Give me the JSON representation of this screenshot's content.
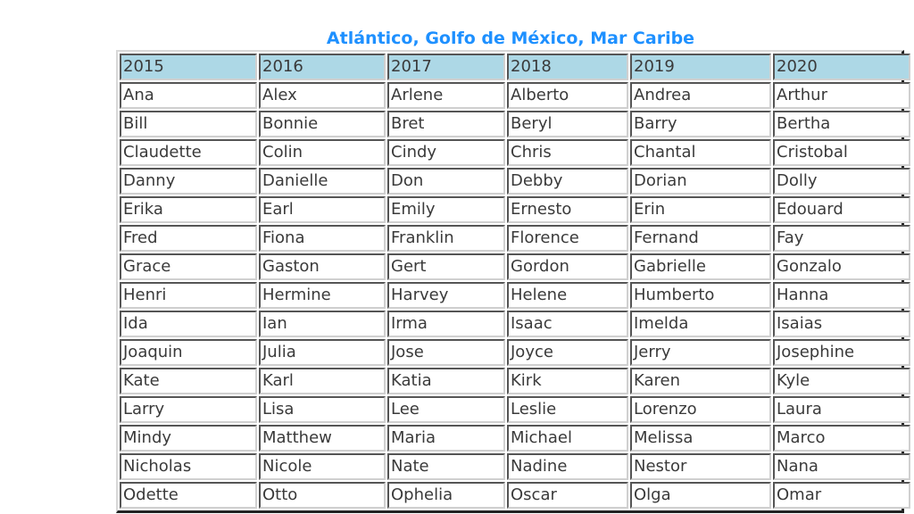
{
  "caption": "Atlántico, Golfo de México, Mar Caribe",
  "table": {
    "headers": [
      "2015",
      "2016",
      "2017",
      "2018",
      "2019",
      "2020"
    ],
    "rows": [
      [
        "Ana",
        "Alex",
        "Arlene",
        "Alberto",
        "Andrea",
        "Arthur"
      ],
      [
        "Bill",
        "Bonnie",
        "Bret",
        "Beryl",
        "Barry",
        "Bertha"
      ],
      [
        "Claudette",
        "Colin",
        "Cindy",
        "Chris",
        "Chantal",
        "Cristobal"
      ],
      [
        "Danny",
        "Danielle",
        "Don",
        "Debby",
        "Dorian",
        "Dolly"
      ],
      [
        "Erika",
        "Earl",
        "Emily",
        "Ernesto",
        "Erin",
        "Edouard"
      ],
      [
        "Fred",
        "Fiona",
        "Franklin",
        "Florence",
        "Fernand",
        "Fay"
      ],
      [
        "Grace",
        "Gaston",
        "Gert",
        "Gordon",
        "Gabrielle",
        "Gonzalo"
      ],
      [
        "Henri",
        "Hermine",
        "Harvey",
        "Helene",
        "Humberto",
        "Hanna"
      ],
      [
        "Ida",
        "Ian",
        "Irma",
        "Isaac",
        "Imelda",
        "Isaias"
      ],
      [
        "Joaquin",
        "Julia",
        "Jose",
        "Joyce",
        "Jerry",
        "Josephine"
      ],
      [
        "Kate",
        "Karl",
        "Katia",
        "Kirk",
        "Karen",
        "Kyle"
      ],
      [
        "Larry",
        "Lisa",
        "Lee",
        "Leslie",
        "Lorenzo",
        "Laura"
      ],
      [
        "Mindy",
        "Matthew",
        "Maria",
        "Michael",
        "Melissa",
        "Marco"
      ],
      [
        "Nicholas",
        "Nicole",
        "Nate",
        "Nadine",
        "Nestor",
        "Nana"
      ],
      [
        "Odette",
        "Otto",
        "Ophelia",
        "Oscar",
        "Olga",
        "Omar"
      ]
    ]
  },
  "colors": {
    "caption": "#1e90ff",
    "header_bg": "#add8e6",
    "cell_bg": "#ffffff",
    "text": "#3a3a3a"
  }
}
